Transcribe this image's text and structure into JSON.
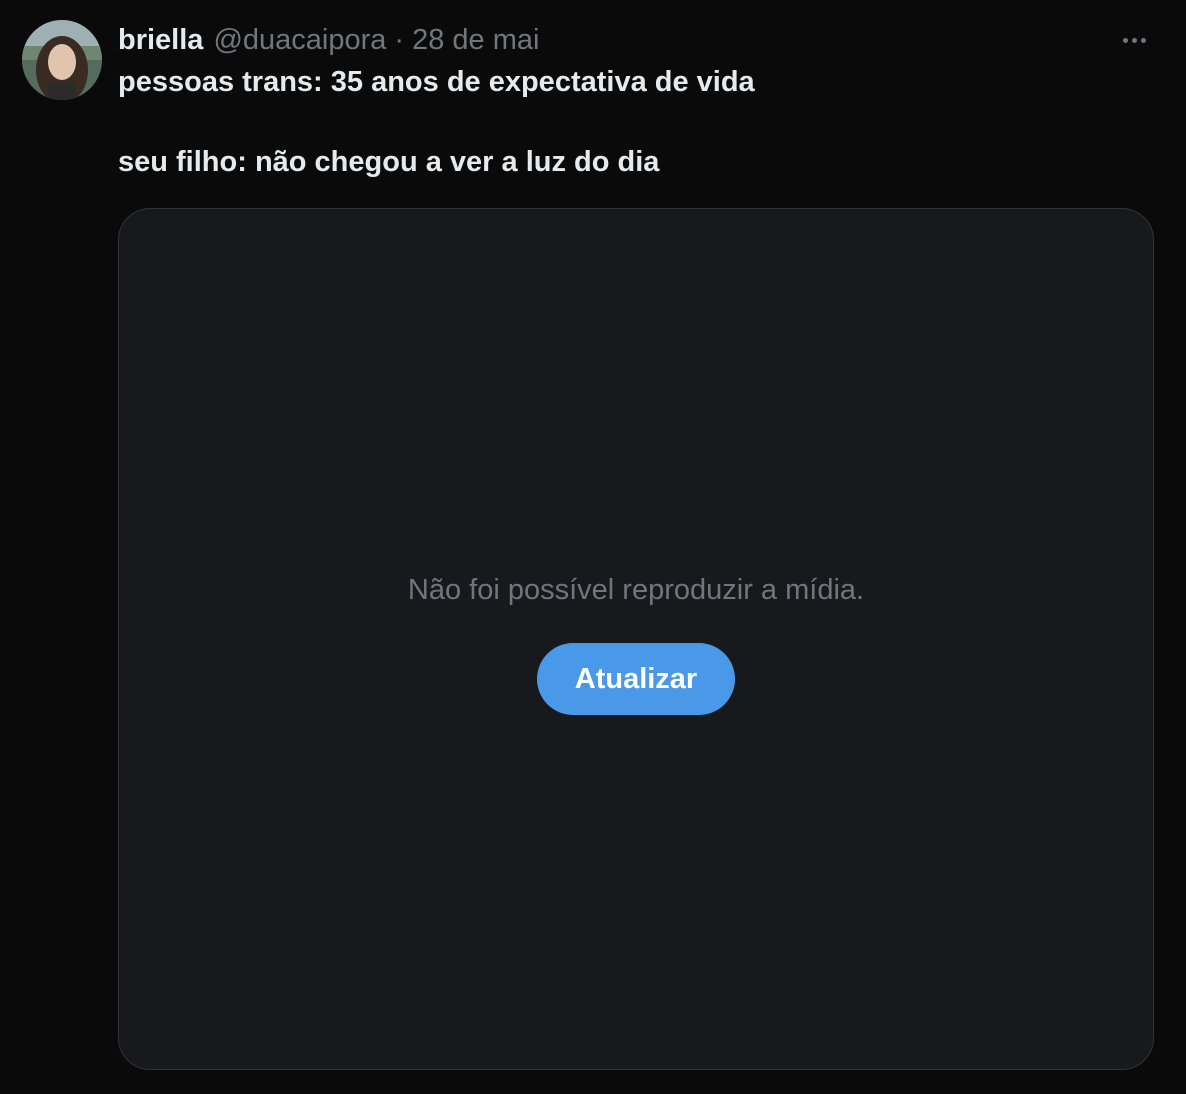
{
  "tweet": {
    "avatar_alt": "avatar",
    "display_name": "briella",
    "handle": "@duacaipora",
    "separator": "·",
    "time": "28 de mai",
    "more_icon": "more-horizontal-icon",
    "text_lines": [
      "pessoas trans: 35 anos de expectativa de vida",
      "seu filho: não chegou a ver a luz do dia"
    ]
  },
  "media": {
    "error_text": "Não foi possível reproduzir a mídia.",
    "refresh_label": "Atualizar",
    "refresh_color": "#4a99e9",
    "background_color": "#18191c"
  },
  "theme": {
    "page_background": "#0a0a0b",
    "primary_text": "#e7e9ea",
    "secondary_text": "#71767b"
  }
}
